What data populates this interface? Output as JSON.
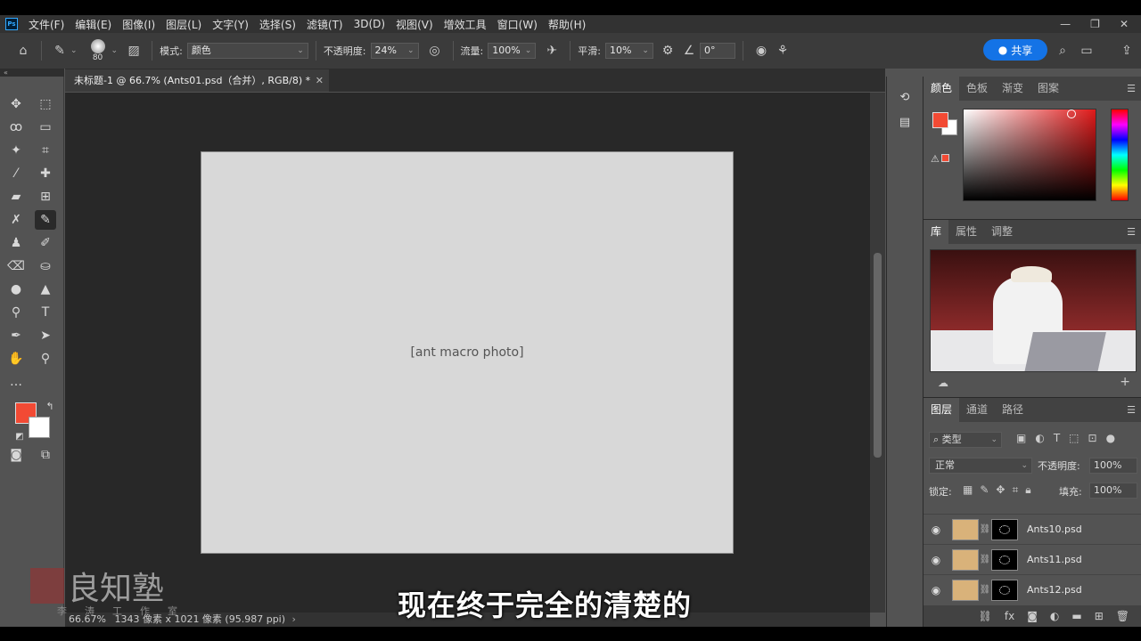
{
  "menu": {
    "items": [
      "文件(F)",
      "编辑(E)",
      "图像(I)",
      "图层(L)",
      "文字(Y)",
      "选择(S)",
      "滤镜(T)",
      "3D(D)",
      "视图(V)",
      "增效工具",
      "窗口(W)",
      "帮助(H)"
    ],
    "window_controls": [
      "—",
      "❐",
      "✕"
    ]
  },
  "options": {
    "brush_size": "80",
    "mode_label": "模式:",
    "mode_value": "颜色",
    "opacity_label": "不透明度:",
    "opacity_value": "24%",
    "flow_label": "流量:",
    "flow_value": "100%",
    "smoothing_label": "平滑:",
    "smoothing_value": "10%",
    "angle_value": "0°",
    "share_label": "共享"
  },
  "document": {
    "tab_title": "未标题-1 @ 66.7% (Ants01.psd（合并）, RGB/8) *",
    "zoom": "66.67%",
    "dimensions": "1343 像素 x 1021 像素 (95.987 ppi)"
  },
  "color_panel": {
    "tabs": [
      "颜色",
      "色板",
      "渐变",
      "图案"
    ],
    "foreground_color": "#f24a34",
    "background_color": "#ffffff"
  },
  "library_panel": {
    "tabs": [
      "库",
      "属性",
      "调整"
    ]
  },
  "layers_panel": {
    "tabs": [
      "图层",
      "通道",
      "路径"
    ],
    "filter_label": "类型",
    "blend_mode": "正常",
    "opacity_label": "不透明度:",
    "opacity_value": "100%",
    "lock_label": "锁定:",
    "fill_label": "填充:",
    "fill_value": "100%",
    "layers": [
      {
        "name": "Ants10.psd"
      },
      {
        "name": "Ants11.psd"
      },
      {
        "name": "Ants12.psd"
      }
    ]
  },
  "subtitle": "现在终于完全的清楚的",
  "watermark": {
    "title": "良知塾",
    "subtitle": "李涛工作室"
  }
}
